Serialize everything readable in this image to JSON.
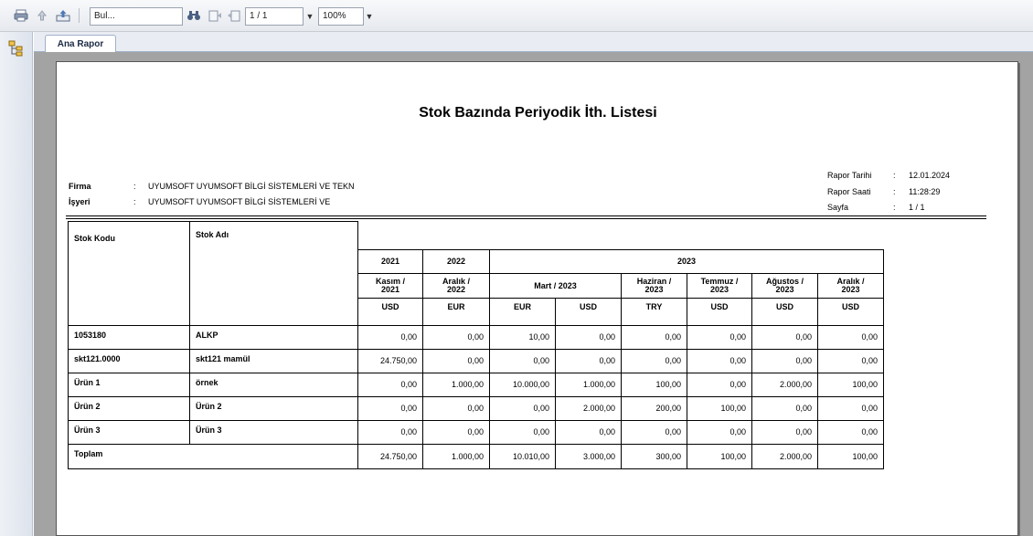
{
  "toolbar": {
    "search_value": "Bul...",
    "page_value": "1 / 1",
    "zoom_value": "100%"
  },
  "tabs": [
    {
      "label": "Ana Rapor"
    }
  ],
  "report": {
    "title": "Stok Bazında Periyodik İth. Listesi",
    "left_meta": [
      {
        "label": "Firma",
        "colon": ":",
        "value": "UYUMSOFT  UYUMSOFT BİLGİ SİSTEMLERİ VE TEKN"
      },
      {
        "label": "İşyeri",
        "colon": ":",
        "value": "UYUMSOFT UYUMSOFT BİLGİ SİSTEMLERİ VE"
      }
    ],
    "right_meta": [
      {
        "label": "Rapor Tarihi",
        "colon": ":",
        "value": "12.01.2024"
      },
      {
        "label": "Rapor Saati",
        "colon": ":",
        "value": "11:28:29"
      },
      {
        "label": "Sayfa",
        "colon": ":",
        "value": "1 / 1"
      }
    ],
    "headers": {
      "stock_code": "Stok Kodu",
      "stock_name": "Stok Adı",
      "years": [
        "2021",
        "2022",
        "2023"
      ],
      "periods": [
        "Kasım /\n2021",
        "Aralık /\n2022",
        "Mart / 2023",
        "Haziran /\n2023",
        "Temmuz /\n2023",
        "Ağustos /\n2023",
        "Aralık /\n2023"
      ],
      "currencies": [
        "USD",
        "EUR",
        "EUR",
        "USD",
        "TRY",
        "USD",
        "USD",
        "USD"
      ]
    },
    "rows": [
      {
        "code": "1053180",
        "name": "ALKP",
        "values": [
          "0,00",
          "0,00",
          "10,00",
          "0,00",
          "0,00",
          "0,00",
          "0,00",
          "0,00"
        ]
      },
      {
        "code": "skt121.0000",
        "name": "skt121 mamül",
        "values": [
          "24.750,00",
          "0,00",
          "0,00",
          "0,00",
          "0,00",
          "0,00",
          "0,00",
          "0,00"
        ]
      },
      {
        "code": "Ürün 1",
        "name": "örnek",
        "values": [
          "0,00",
          "1.000,00",
          "10.000,00",
          "1.000,00",
          "100,00",
          "0,00",
          "2.000,00",
          "100,00"
        ]
      },
      {
        "code": "Ürün 2",
        "name": "Ürün 2",
        "values": [
          "0,00",
          "0,00",
          "0,00",
          "2.000,00",
          "200,00",
          "100,00",
          "0,00",
          "0,00"
        ]
      },
      {
        "code": "Ürün 3",
        "name": "Ürün 3",
        "values": [
          "0,00",
          "0,00",
          "0,00",
          "0,00",
          "0,00",
          "0,00",
          "0,00",
          "0,00"
        ]
      }
    ],
    "total": {
      "label": "Toplam",
      "values": [
        "24.750,00",
        "1.000,00",
        "10.010,00",
        "3.000,00",
        "300,00",
        "100,00",
        "2.000,00",
        "100,00"
      ]
    }
  }
}
